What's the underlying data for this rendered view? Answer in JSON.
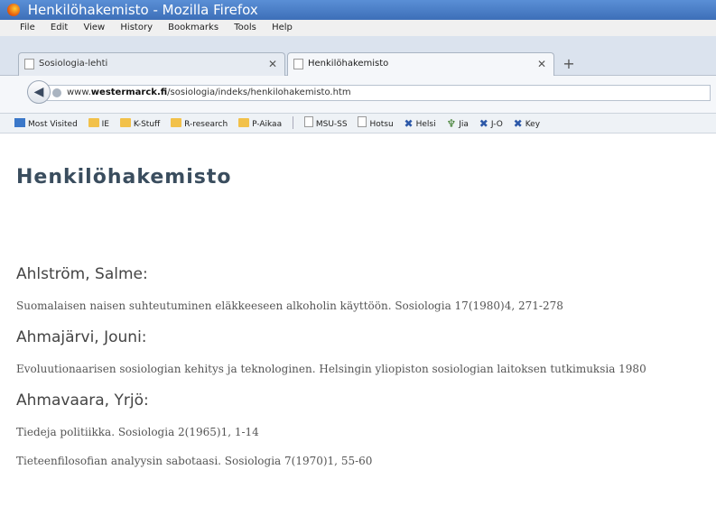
{
  "window": {
    "title": "Henkilöhakemisto - Mozilla Firefox"
  },
  "menu": {
    "items": [
      "File",
      "Edit",
      "View",
      "History",
      "Bookmarks",
      "Tools",
      "Help"
    ]
  },
  "tabs": [
    {
      "label": "Sosiologia-lehti",
      "active": false
    },
    {
      "label": "Henkilöhakemisto",
      "active": true
    }
  ],
  "navigation": {
    "url_prefix": "www.",
    "url_domain": "westermarck.fi",
    "url_path": "/sosiologia/indeks/henkilohakemisto.htm"
  },
  "bookmarks": [
    {
      "label": "Most Visited",
      "icon": "most-visited-icon"
    },
    {
      "label": "IE",
      "icon": "folder-icon"
    },
    {
      "label": "K-Stuff",
      "icon": "folder-icon"
    },
    {
      "label": "R-research",
      "icon": "folder-icon"
    },
    {
      "label": "P-Aikaa",
      "icon": "folder-icon"
    },
    {
      "label": "MSU-SS",
      "icon": "page-icon"
    },
    {
      "label": "Hotsu",
      "icon": "page-icon"
    },
    {
      "label": "Helsi",
      "icon": "x-icon"
    },
    {
      "label": "Jia",
      "icon": "tree-icon"
    },
    {
      "label": "J-O",
      "icon": "x-icon"
    },
    {
      "label": "Key",
      "icon": "x-icon"
    }
  ],
  "page": {
    "title": "Henkilöhakemisto",
    "entries": [
      {
        "name": "Ahlström, Salme:",
        "works": [
          "Suomalaisen naisen suhteutuminen eläkkeeseen alkoholin käyttöön. Sosiologia 17(1980)4, 271-278"
        ]
      },
      {
        "name": "Ahmajärvi, Jouni:",
        "works": [
          "Evoluutionaarisen sosiologian kehitys ja teknologinen. Helsingin yliopiston sosiologian laitoksen tutkimuksia 1980"
        ]
      },
      {
        "name": "Ahmavaara, Yrjö:",
        "works": [
          "Tiedeja politiikka. Sosiologia 2(1965)1, 1-14",
          "Tieteenfilosofian analyysin sabotaasi. Sosiologia 7(1970)1, 55-60"
        ]
      }
    ]
  }
}
